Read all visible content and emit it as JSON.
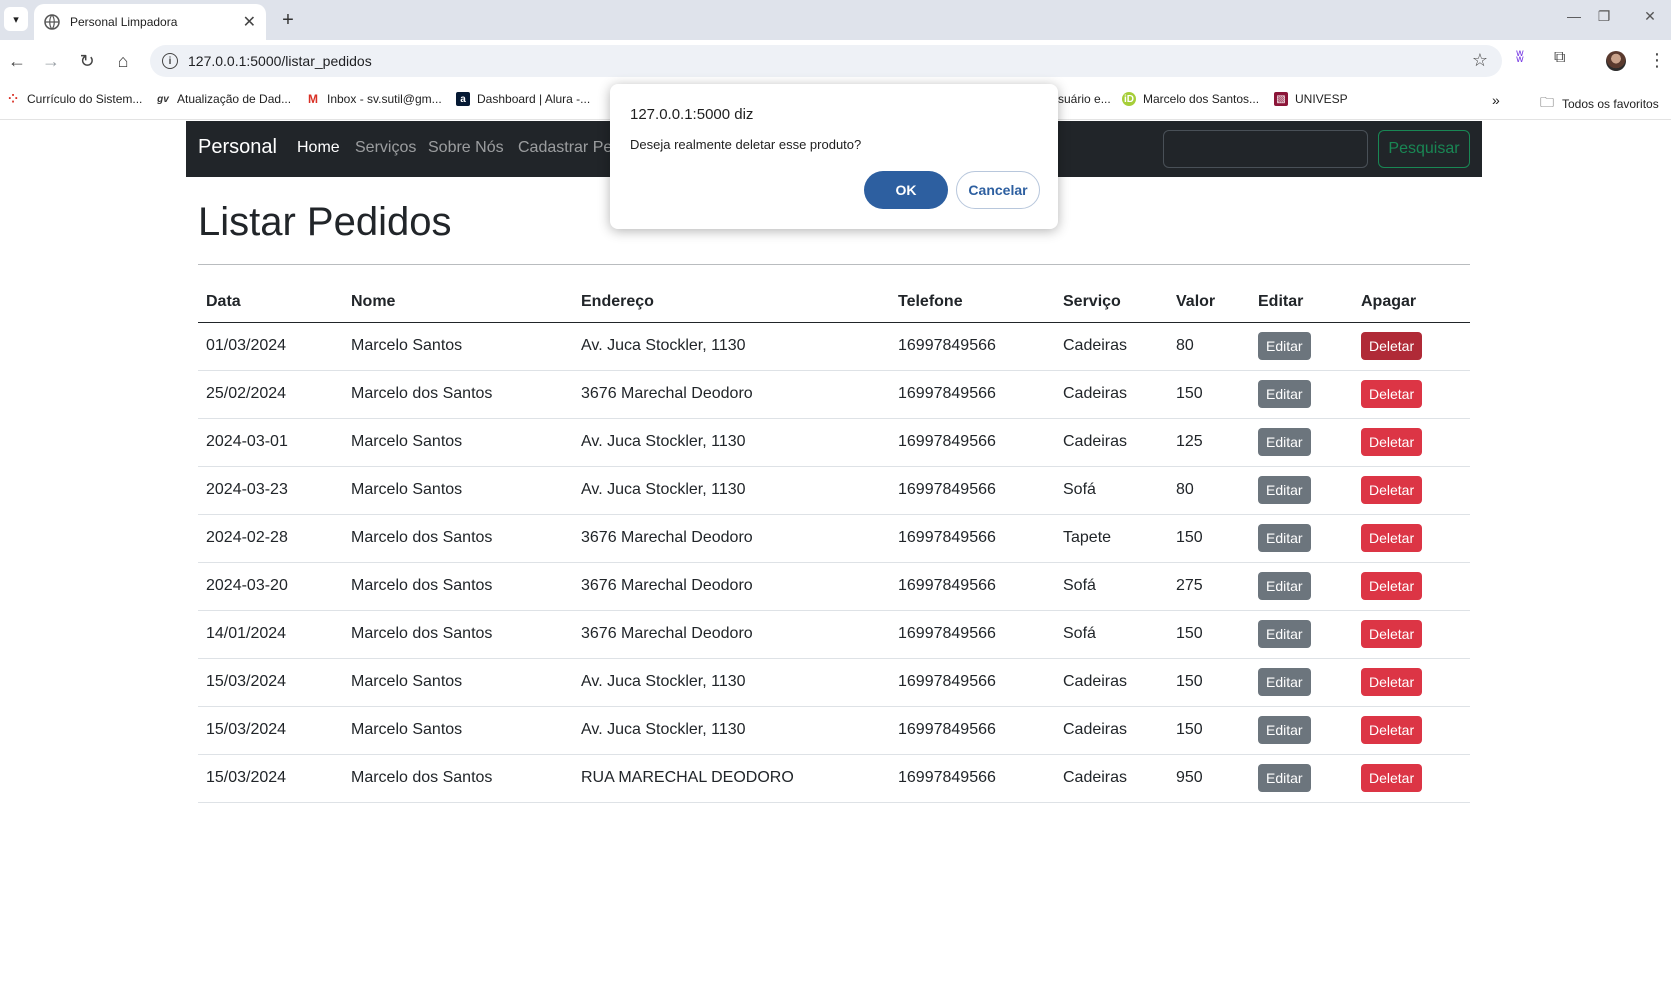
{
  "browser": {
    "tab_title": "Personal Limpadora",
    "url": "127.0.0.1:5000/listar_pedidos",
    "bookmarks": [
      {
        "label": "Currículo do Sistem...",
        "icon": "dots-icon"
      },
      {
        "label": "Atualização de Dad...",
        "icon": "gv-icon"
      },
      {
        "label": "Inbox - sv.sutil@gm...",
        "icon": "gmail-icon"
      },
      {
        "label": "Dashboard | Alura -...",
        "icon": "alura-icon"
      },
      {
        "label": "suário e...",
        "icon": ""
      },
      {
        "label": "Marcelo dos Santos...",
        "icon": "orcid-icon"
      },
      {
        "label": "UNIVESP",
        "icon": "univesp-icon"
      }
    ],
    "all_bookmarks_label": "Todos os favoritos"
  },
  "navbar": {
    "brand": "Personal",
    "links": [
      "Home",
      "Serviços",
      "Sobre Nós",
      "Cadastrar Pe"
    ],
    "search_button": "Pesquisar"
  },
  "page": {
    "title": "Listar Pedidos"
  },
  "table": {
    "headers": [
      "Data",
      "Nome",
      "Endereço",
      "Telefone",
      "Serviço",
      "Valor",
      "Editar",
      "Apagar"
    ],
    "edit_label": "Editar",
    "delete_label": "Deletar",
    "rows": [
      {
        "data": "01/03/2024",
        "nome": "Marcelo Santos",
        "endereco": "Av. Juca Stockler, 1130",
        "telefone": "16997849566",
        "servico": "Cadeiras",
        "valor": "80"
      },
      {
        "data": "25/02/2024",
        "nome": "Marcelo dos Santos",
        "endereco": "3676 Marechal Deodoro",
        "telefone": "16997849566",
        "servico": "Cadeiras",
        "valor": "150"
      },
      {
        "data": "2024-03-01",
        "nome": "Marcelo Santos",
        "endereco": "Av. Juca Stockler, 1130",
        "telefone": "16997849566",
        "servico": "Cadeiras",
        "valor": "125"
      },
      {
        "data": "2024-03-23",
        "nome": "Marcelo Santos",
        "endereco": "Av. Juca Stockler, 1130",
        "telefone": "16997849566",
        "servico": "Sofá",
        "valor": "80"
      },
      {
        "data": "2024-02-28",
        "nome": "Marcelo dos Santos",
        "endereco": "3676 Marechal Deodoro",
        "telefone": "16997849566",
        "servico": "Tapete",
        "valor": "150"
      },
      {
        "data": "2024-03-20",
        "nome": "Marcelo dos Santos",
        "endereco": "3676 Marechal Deodoro",
        "telefone": "16997849566",
        "servico": "Sofá",
        "valor": "275"
      },
      {
        "data": "14/01/2024",
        "nome": "Marcelo dos Santos",
        "endereco": "3676 Marechal Deodoro",
        "telefone": "16997849566",
        "servico": "Sofá",
        "valor": "150"
      },
      {
        "data": "15/03/2024",
        "nome": "Marcelo Santos",
        "endereco": "Av. Juca Stockler, 1130",
        "telefone": "16997849566",
        "servico": "Cadeiras",
        "valor": "150"
      },
      {
        "data": "15/03/2024",
        "nome": "Marcelo Santos",
        "endereco": "Av. Juca Stockler, 1130",
        "telefone": "16997849566",
        "servico": "Cadeiras",
        "valor": "150"
      },
      {
        "data": "15/03/2024",
        "nome": "Marcelo dos Santos",
        "endereco": "RUA MARECHAL DEODORO",
        "telefone": "16997849566",
        "servico": "Cadeiras",
        "valor": "950"
      }
    ]
  },
  "dialog": {
    "title": "127.0.0.1:5000 diz",
    "message": "Deseja realmente deletar esse produto?",
    "ok_label": "OK",
    "cancel_label": "Cancelar"
  }
}
